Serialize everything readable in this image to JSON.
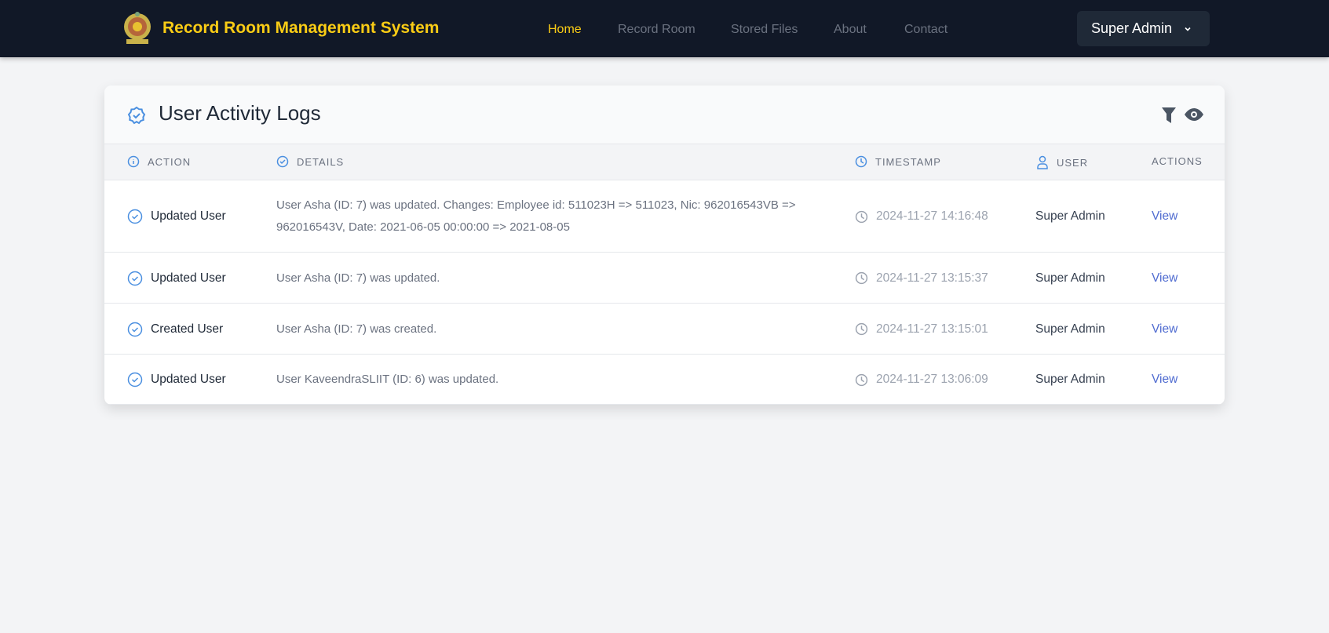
{
  "nav": {
    "brand": "Record Room Management System",
    "items": [
      {
        "label": "Home",
        "active": true
      },
      {
        "label": "Record Room"
      },
      {
        "label": "Stored Files"
      },
      {
        "label": "About"
      },
      {
        "label": "Contact"
      }
    ],
    "user_menu": "Super Admin"
  },
  "card": {
    "title": "User Activity Logs",
    "columns": {
      "action": "ACTION",
      "details": "DETAILS",
      "timestamp": "TIMESTAMP",
      "user": "USER",
      "actions": "ACTIONS"
    },
    "rows": [
      {
        "action": "Updated User",
        "details": "User Asha (ID: 7) was updated. Changes: Employee id: 511023H => 511023, Nic: 962016543VB => 962016543V, Date: 2021-06-05 00:00:00 => 2021-08-05",
        "timestamp": "2024-11-27 14:16:48",
        "user": "Super Admin",
        "link": "View"
      },
      {
        "action": "Updated User",
        "details": "User Asha (ID: 7) was updated.",
        "timestamp": "2024-11-27 13:15:37",
        "user": "Super Admin",
        "link": "View"
      },
      {
        "action": "Created User",
        "details": "User Asha (ID: 7) was created.",
        "timestamp": "2024-11-27 13:15:01",
        "user": "Super Admin",
        "link": "View"
      },
      {
        "action": "Updated User",
        "details": "User KaveendraSLIIT (ID: 6) was updated.",
        "timestamp": "2024-11-27 13:06:09",
        "user": "Super Admin",
        "link": "View"
      }
    ]
  },
  "colors": {
    "nav": "#111827",
    "accent": "#facc15",
    "link": "#4f6bd0",
    "icon": "#4a8fe0"
  }
}
